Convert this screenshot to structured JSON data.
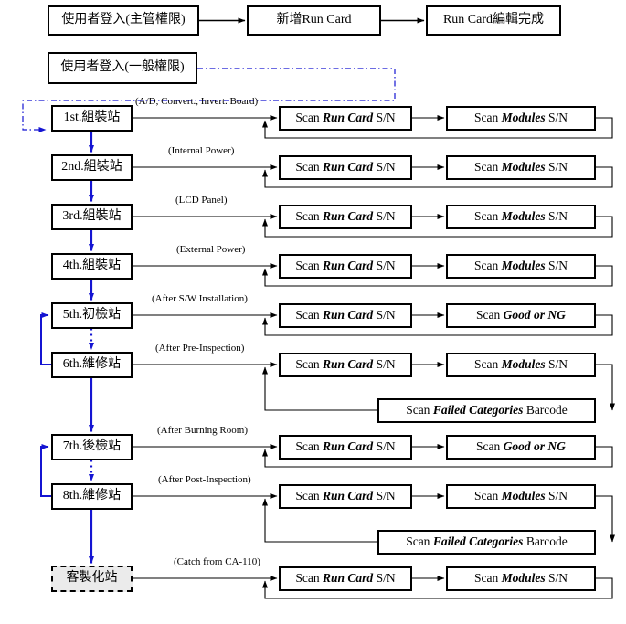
{
  "diagram": {
    "title": "Run Card production flow",
    "colors": {
      "line": "#000000",
      "flow_arrow": "#1414d2",
      "custom_station_fill": "#ebebeb"
    }
  },
  "top_flow": {
    "admin_login": "使用者登入(主管權限)",
    "new_run_card": "新增Run Card",
    "run_card_done": "Run Card編輯完成",
    "user_login": "使用者登入(一般權限)"
  },
  "scan_labels": {
    "run_card": {
      "prefix": "Scan ",
      "emph": "Run Card",
      "suffix": " S/N"
    },
    "modules": {
      "prefix": "Scan ",
      "emph": "Modules",
      "suffix": " S/N"
    },
    "good_or_ng": {
      "prefix": "Scan ",
      "emph": "Good or NG",
      "suffix": ""
    },
    "failed": {
      "prefix": "Scan ",
      "emph": "Failed Categories",
      "suffix": " Barcode"
    }
  },
  "rows": [
    {
      "station": "1st.組裝站",
      "note": "(A/D, Convert., Invert. Board)",
      "second": "modules",
      "failed": false,
      "dashed": false
    },
    {
      "station": "2nd.組裝站",
      "note": "(Internal Power)",
      "second": "modules",
      "failed": false,
      "dashed": false
    },
    {
      "station": "3rd.組裝站",
      "note": "(LCD Panel)",
      "second": "modules",
      "failed": false,
      "dashed": false
    },
    {
      "station": "4th.組裝站",
      "note": "(External Power)",
      "second": "modules",
      "failed": false,
      "dashed": false
    },
    {
      "station": "5th.初檢站",
      "note": "(After S/W Installation)",
      "second": "good_or_ng",
      "failed": false,
      "dashed": false
    },
    {
      "station": "6th.維修站",
      "note": "(After Pre-Inspection)",
      "second": "modules",
      "failed": true,
      "dashed": false
    },
    {
      "station": "7th.後檢站",
      "note": "(After Burning Room)",
      "second": "good_or_ng",
      "failed": false,
      "dashed": false
    },
    {
      "station": "8th.維修站",
      "note": "(After Post-Inspection)",
      "second": "modules",
      "failed": true,
      "dashed": false
    },
    {
      "station": "客製化站",
      "note": "(Catch from CA-110)",
      "second": "modules",
      "failed": false,
      "dashed": true
    }
  ]
}
